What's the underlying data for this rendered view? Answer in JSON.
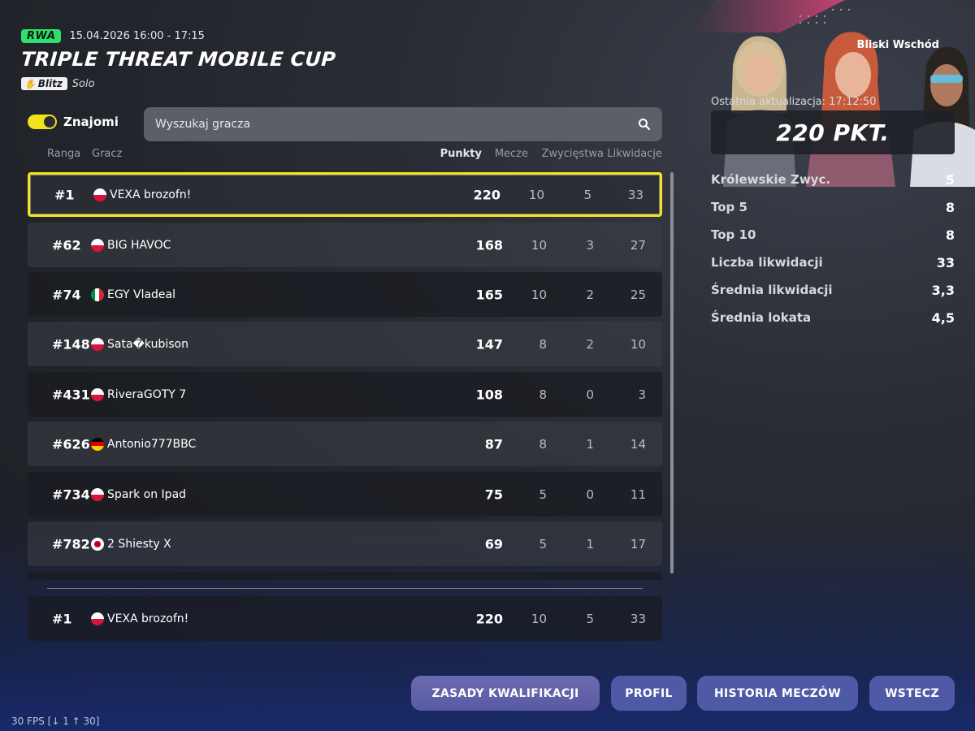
{
  "header": {
    "region_badge": "RWA",
    "date": "15.04.2026 16:00 - 17:15",
    "title": "TRIPLE THREAT MOBILE CUP",
    "mode_badge": "Blitz",
    "mode_type": "Solo"
  },
  "controls": {
    "toggle_label": "Znajomi",
    "toggle_on": true,
    "search_placeholder": "Wyszukaj gracza"
  },
  "columns": {
    "rank": "Ranga",
    "player": "Gracz",
    "points": "Punkty",
    "matches": "Mecze",
    "wins": "Zwycięstwa",
    "eliminations": "Likwidacje"
  },
  "rows": [
    {
      "rank": "#1",
      "flag": "pl",
      "name": "VEXA brozofn!",
      "points": "220",
      "matches": "10",
      "wins": "5",
      "elims": "33"
    },
    {
      "rank": "#62",
      "flag": "pl",
      "name": "BIG HAVOC",
      "points": "168",
      "matches": "10",
      "wins": "3",
      "elims": "27"
    },
    {
      "rank": "#74",
      "flag": "it",
      "name": "EGY Vladeal",
      "points": "165",
      "matches": "10",
      "wins": "2",
      "elims": "25"
    },
    {
      "rank": "#148",
      "flag": "pl",
      "name": "Sata�kubison",
      "points": "147",
      "matches": "8",
      "wins": "2",
      "elims": "10"
    },
    {
      "rank": "#431",
      "flag": "pl",
      "name": "RiveraGOTY 7",
      "points": "108",
      "matches": "8",
      "wins": "0",
      "elims": "3"
    },
    {
      "rank": "#626",
      "flag": "de",
      "name": "Antonio777BBC",
      "points": "87",
      "matches": "8",
      "wins": "1",
      "elims": "14"
    },
    {
      "rank": "#734",
      "flag": "pl",
      "name": "Spark on Ipad",
      "points": "75",
      "matches": "5",
      "wins": "0",
      "elims": "11"
    },
    {
      "rank": "#782",
      "flag": "jp",
      "name": "2 Shiesty X",
      "points": "69",
      "matches": "5",
      "wins": "1",
      "elims": "17"
    }
  ],
  "my_row": {
    "rank": "#1",
    "flag": "pl",
    "name": "VEXA brozofn!",
    "points": "220",
    "matches": "10",
    "wins": "5",
    "elims": "33"
  },
  "panel": {
    "region_name": "Bliski Wschód",
    "updated": "Ostatnia aktualizacja: 17:12:50",
    "points_total": "220 PKT.",
    "stats": [
      {
        "label": "Królewskie Zwyc.",
        "value": "5"
      },
      {
        "label": "Top 5",
        "value": "8"
      },
      {
        "label": "Top 10",
        "value": "8"
      },
      {
        "label": "Liczba likwidacji",
        "value": "33"
      },
      {
        "label": "Średnia likwidacji",
        "value": "3,3"
      },
      {
        "label": "Średnia lokata",
        "value": "4,5"
      }
    ]
  },
  "buttons": {
    "rules": "ZASADY KWALIFIKACJI",
    "profile": "PROFIL",
    "history": "HISTORIA MECZÓW",
    "back": "WSTECZ"
  },
  "fps": "30 FPS [↓  1 ↑ 30]",
  "colors": {
    "accent_yellow": "#f2e41a",
    "region_green": "#2ddf6c",
    "button_blue": "#4e5aa6"
  }
}
